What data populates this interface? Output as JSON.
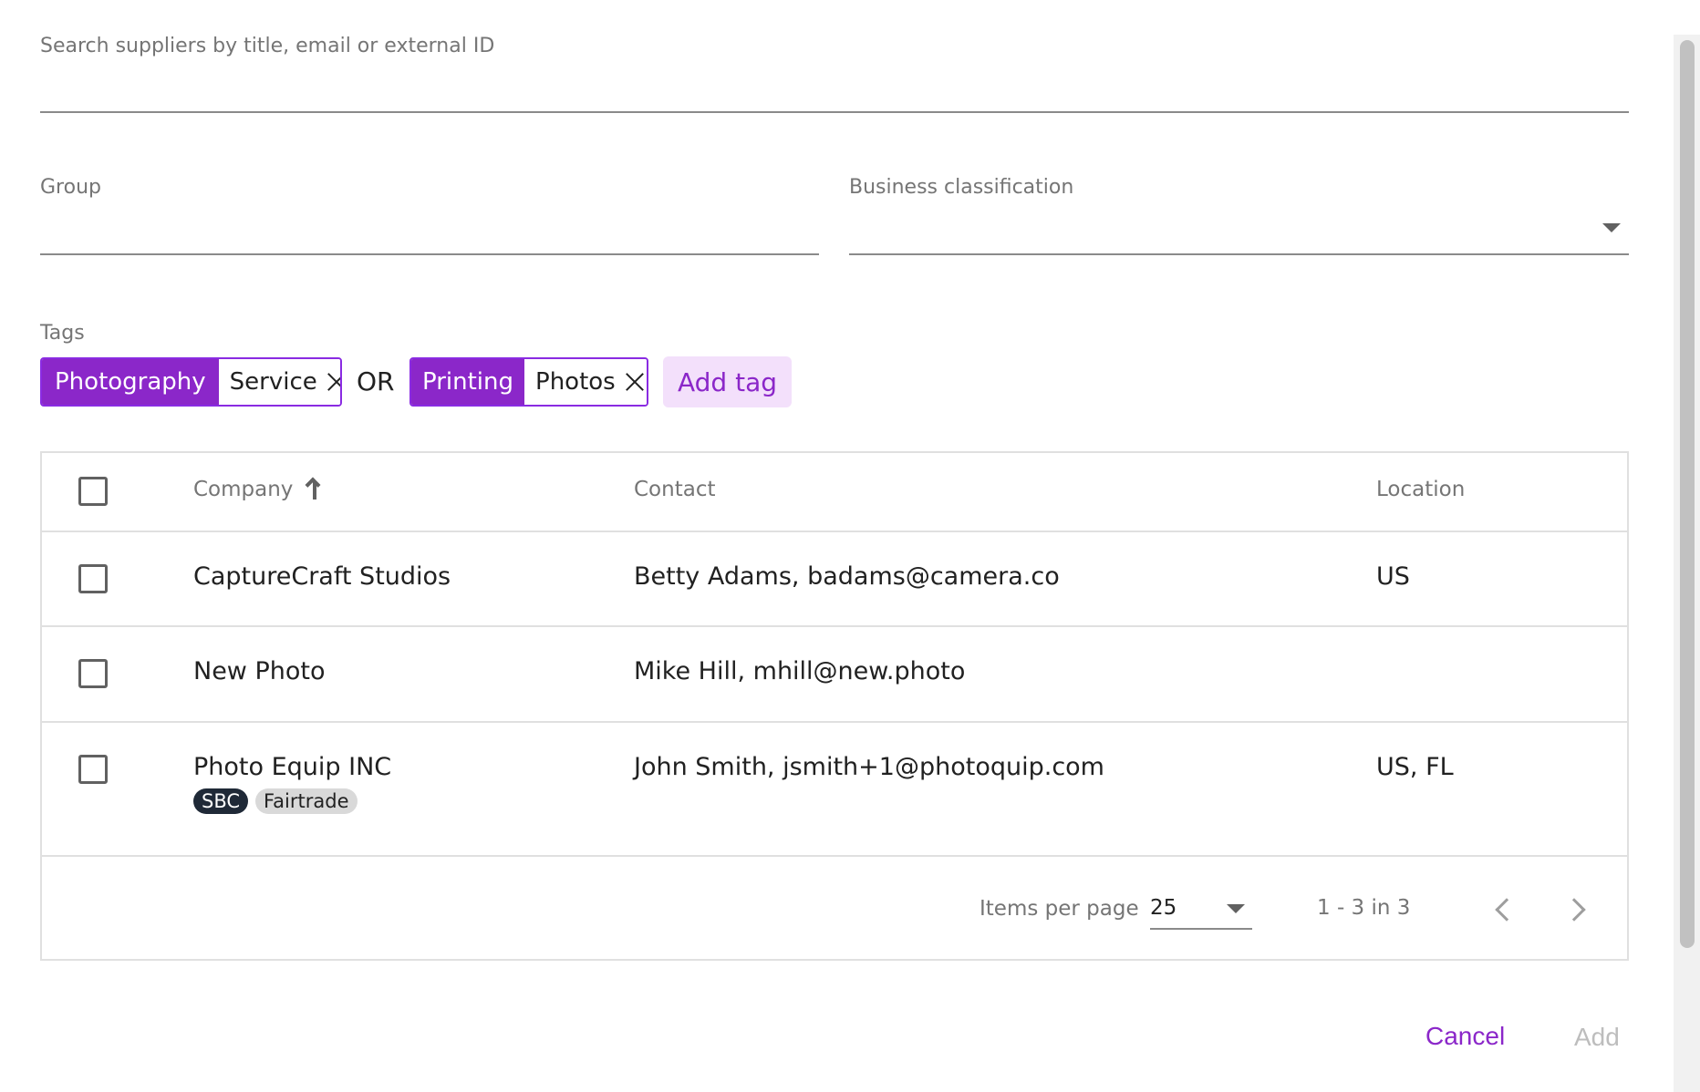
{
  "search": {
    "label": "Search suppliers by title, email or external ID",
    "value": ""
  },
  "group": {
    "label": "Group",
    "value": ""
  },
  "business_classification": {
    "label": "Business classification",
    "value": ""
  },
  "tags": {
    "label": "Tags",
    "groups": [
      {
        "category": "Photography",
        "value": "Service"
      },
      {
        "category": "Printing",
        "value": "Photos"
      }
    ],
    "operator": "OR",
    "add_label": "Add tag"
  },
  "table": {
    "headers": {
      "company": "Company",
      "contact": "Contact",
      "location": "Location"
    },
    "rows": [
      {
        "company": "CaptureCraft Studios",
        "contact": "Betty Adams, badams@camera.co",
        "location": "US",
        "badges": []
      },
      {
        "company": "New Photo",
        "contact": "Mike Hill, mhill@new.photo",
        "location": "",
        "badges": []
      },
      {
        "company": "Photo Equip INC",
        "contact": "John Smith, jsmith+1@photoquip.com",
        "location": "US, FL",
        "badges": [
          "SBC",
          "Fairtrade"
        ]
      }
    ]
  },
  "pagination": {
    "items_per_page_label": "Items per page",
    "items_per_page": "25",
    "range": "1 - 3 in 3"
  },
  "actions": {
    "cancel": "Cancel",
    "add": "Add"
  },
  "colors": {
    "accent": "#8b27c9",
    "accent_light": "#f3e0fb",
    "border": "#e0e0e0",
    "disabled": "#bdbdbd"
  },
  "icons": {
    "sort": "arrow-up-icon",
    "remove_tag": "close-icon",
    "dropdown": "caret-down-icon",
    "prev_page": "chevron-left-icon",
    "next_page": "chevron-right-icon"
  }
}
